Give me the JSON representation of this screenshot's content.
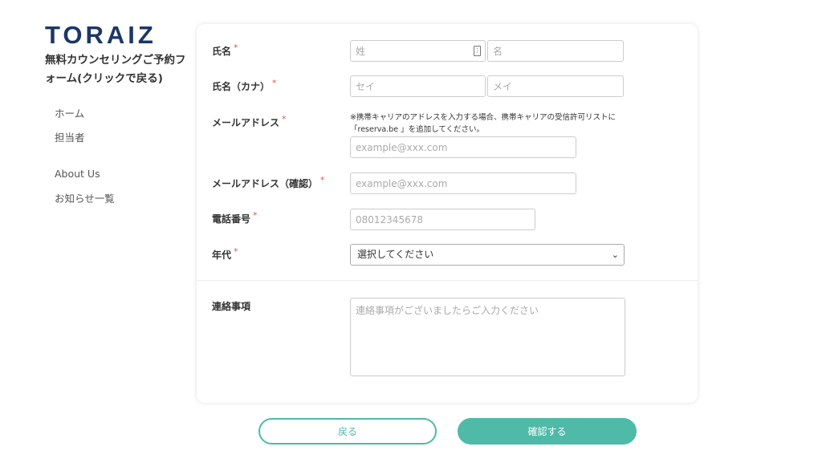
{
  "brand": {
    "logo": "TORAIZ"
  },
  "form_title": "無料カウンセリングご予約フォーム(クリックで戻る)",
  "sidebar": {
    "items": [
      {
        "label": "ホーム"
      },
      {
        "label": "担当者"
      },
      {
        "label": "About Us"
      },
      {
        "label": "お知らせ一覧"
      }
    ]
  },
  "form": {
    "required_mark": "*",
    "name": {
      "label": "氏名",
      "last_placeholder": "姓",
      "first_placeholder": "名"
    },
    "kana": {
      "label": "氏名（カナ）",
      "last_placeholder": "セイ",
      "first_placeholder": "メイ"
    },
    "email": {
      "label": "メールアドレス",
      "note": "※携帯キャリアのアドレスを入力する場合、携帯キャリアの受信許可リストに「reserva.be 」を追加してください。",
      "placeholder": "example@xxx.com"
    },
    "email_confirm": {
      "label": "メールアドレス（確認）",
      "placeholder": "example@xxx.com"
    },
    "phone": {
      "label": "電話番号",
      "placeholder": "08012345678"
    },
    "age": {
      "label": "年代",
      "selected": "選択してください"
    },
    "notes": {
      "label": "連絡事項",
      "placeholder": "連絡事項がございましたらご入力ください"
    }
  },
  "buttons": {
    "back": "戻る",
    "confirm": "確認する"
  },
  "colors": {
    "brand": "#1c3766",
    "accent": "#4ebaa7",
    "required": "#e05555"
  }
}
